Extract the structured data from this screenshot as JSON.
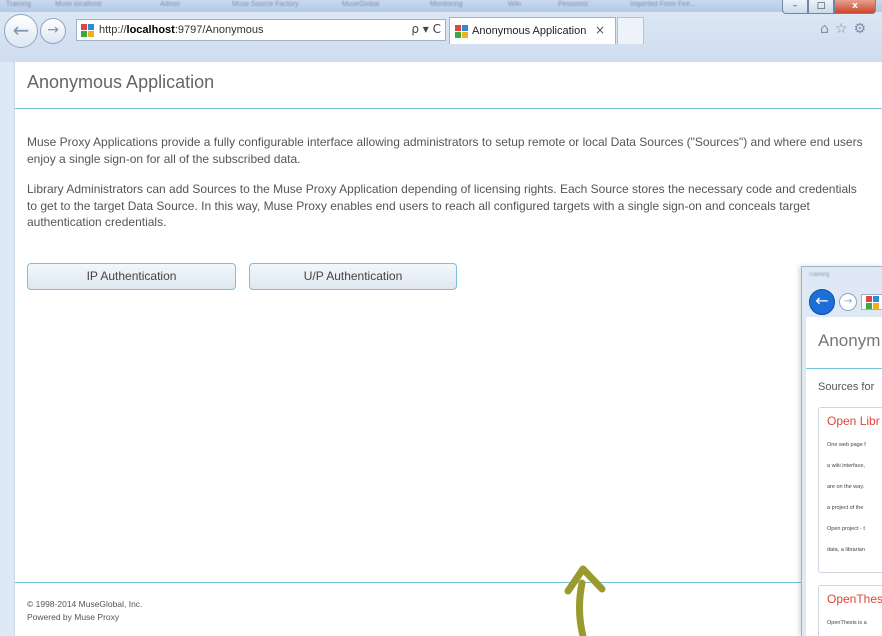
{
  "window": {
    "favorites": [
      "Training",
      "Muse localhost",
      "Admin",
      "Muse Source Factory",
      "MuseGlobal",
      "Monitoring",
      "Wiki",
      "Pessimist",
      "Imported From Fire..."
    ],
    "controls": {
      "minimize": "–",
      "maximize": "□",
      "close": "x"
    }
  },
  "browser": {
    "back_icon": "back-arrow-icon",
    "forward_icon": "forward-arrow-icon",
    "url_prefix": "http://",
    "url_host": "localhost",
    "url_rest": ":9797/Anonymous",
    "address_tools": "ρ ▾ C",
    "tab_title": "Anonymous Application",
    "tab_close": "×",
    "toolbar_icons": [
      "home-icon",
      "favorites-star-icon",
      "settings-gear-icon"
    ]
  },
  "page": {
    "title": "Anonymous Application",
    "paragraph1": "Muse Proxy Applications provide a fully configurable interface allowing administrators to setup remote or local Data Sources (\"Sources\") and where end users enjoy a single sign-on for all of the subscribed data.",
    "paragraph2": "Library Administrators can add Sources to the Muse Proxy Application depending of licensing rights. Each Source stores the necessary code and credentials to get to the target Data Source. In this way, Muse Proxy enables end users to reach all configured targets with a single sign-on and conceals target authentication credentials.",
    "buttons": {
      "ip_auth": "IP Authentication",
      "up_auth": "U/P Authentication"
    },
    "footer_copyright": "© 1998-2014 MuseGlobal, Inc.",
    "footer_powered": "Powered by Muse Proxy"
  },
  "overlay_window": {
    "title_text": "Training",
    "heading": "Anonym",
    "sources_label": "Sources for",
    "card1_title": "Open Libr",
    "card1_lines": [
      "One web page f",
      "a wiki interface,",
      "are on the way.",
      "a project of the",
      "Open project - t",
      "data, a librarian"
    ],
    "card2_title": "OpenThes",
    "card2_line": "OpenThesis is a"
  },
  "colors": {
    "accent_rule": "#74c2da",
    "card_title_red": "#e0443a",
    "arrow_olive": "#9a9a2e",
    "back_button_blue": "#1d6fd8"
  }
}
